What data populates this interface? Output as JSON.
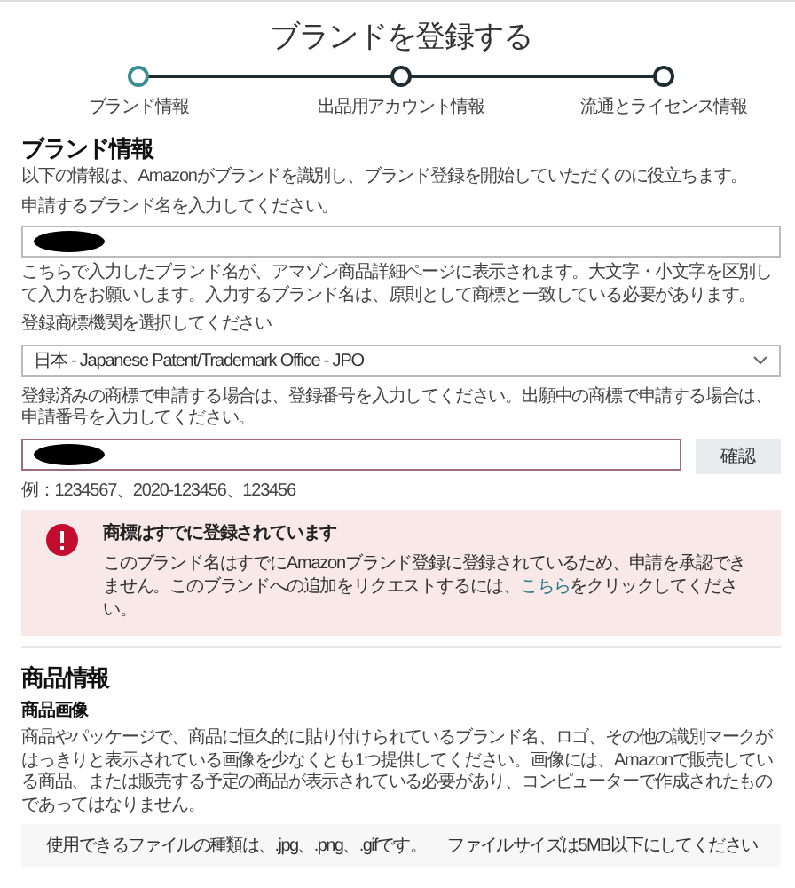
{
  "title": "ブランドを登録する",
  "steps": [
    {
      "label": "ブランド情報",
      "selected": true
    },
    {
      "label": "出品用アカウント情報",
      "selected": false
    },
    {
      "label": "流通とライセンス情報",
      "selected": false
    }
  ],
  "brand_info": {
    "heading": "ブランド情報",
    "intro": "以下の情報は、Amazonがブランドを識別し、ブランド登録を開始していただくのに役立ちます。",
    "brand_name": {
      "label": "申請するブランド名を入力してください。",
      "redacted": true,
      "help": "こちらで入力したブランド名が、アマゾン商品詳細ページに表示されます。大文字・小文字を区別して入力をお願いします。入力するブランド名は、原則として商標と一致している必要があります。"
    },
    "office": {
      "label": "登録商標機関を選択してください",
      "value": "日本 - Japanese Patent/Trademark Office - JPO"
    },
    "number": {
      "label": "登録済みの商標で申請する場合は、登録番号を入力してください。出願中の商標で申請する場合は、申請番号を入力してください。",
      "redacted": true,
      "invalid": true,
      "button": "確認",
      "example": "例：1234567、2020-123456、123456"
    },
    "alert": {
      "title": "商標はすでに登録されています",
      "text_before": "このブランド名はすでにAmazonブランド登録に登録されているため、申請を承認できません。このブランドへの追加をリクエストするには、",
      "link": "こちら",
      "text_after": "をクリックしてください。"
    }
  },
  "product_info": {
    "heading": "商品情報",
    "subheading": "商品画像",
    "text": "商品やパッケージで、商品に恒久的に貼り付けられているブランド名、ロゴ、その他の識別マークがはっきりと表示されている画像を少なくとも1つ提供してください。画像には、Amazonで販売している商品、または販売する予定の商品が表示されている必要があり、コンピューターで作成されたものであってはなりません。",
    "file_types": "使用できるファイルの種類は、.jpg、.png、.gifです。",
    "file_size": "ファイルサイズは5MB以下にしてください"
  }
}
